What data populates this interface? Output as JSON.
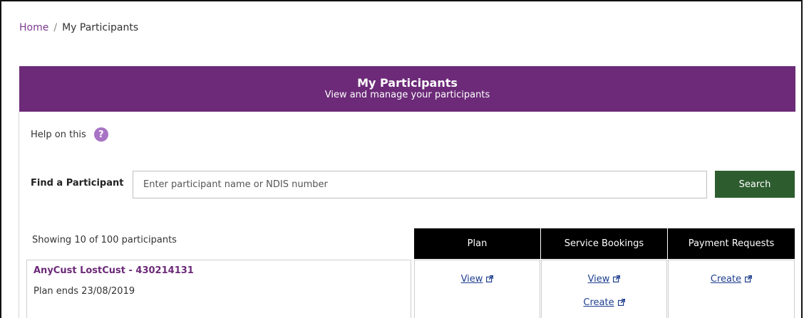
{
  "breadcrumb": {
    "home": "Home",
    "separator": "/",
    "current": "My Participants"
  },
  "banner": {
    "title": "My Participants",
    "subtitle": "View and manage your participants"
  },
  "help": {
    "label": "Help on this",
    "icon": "?"
  },
  "search": {
    "label": "Find a Participant",
    "placeholder": "Enter participant name or NDIS number",
    "value": "",
    "button": "Search"
  },
  "results": {
    "showing": "Showing 10 of 100 participants"
  },
  "table": {
    "headers": [
      "Plan",
      "Service Bookings",
      "Payment Requests"
    ],
    "rows": [
      {
        "name": "AnyCust LostCust - 430214131",
        "plan_ends": "Plan ends 23/08/2019",
        "plan_link": "View",
        "bookings_view": "View",
        "bookings_create": "Create",
        "payment_create": "Create"
      }
    ]
  },
  "colors": {
    "banner": "#6c2a78",
    "search_button": "#2d5d2f",
    "link": "#1f3f8f",
    "header_bg": "#000000"
  },
  "icons": {
    "external": "external-link-icon",
    "help": "help-icon"
  }
}
